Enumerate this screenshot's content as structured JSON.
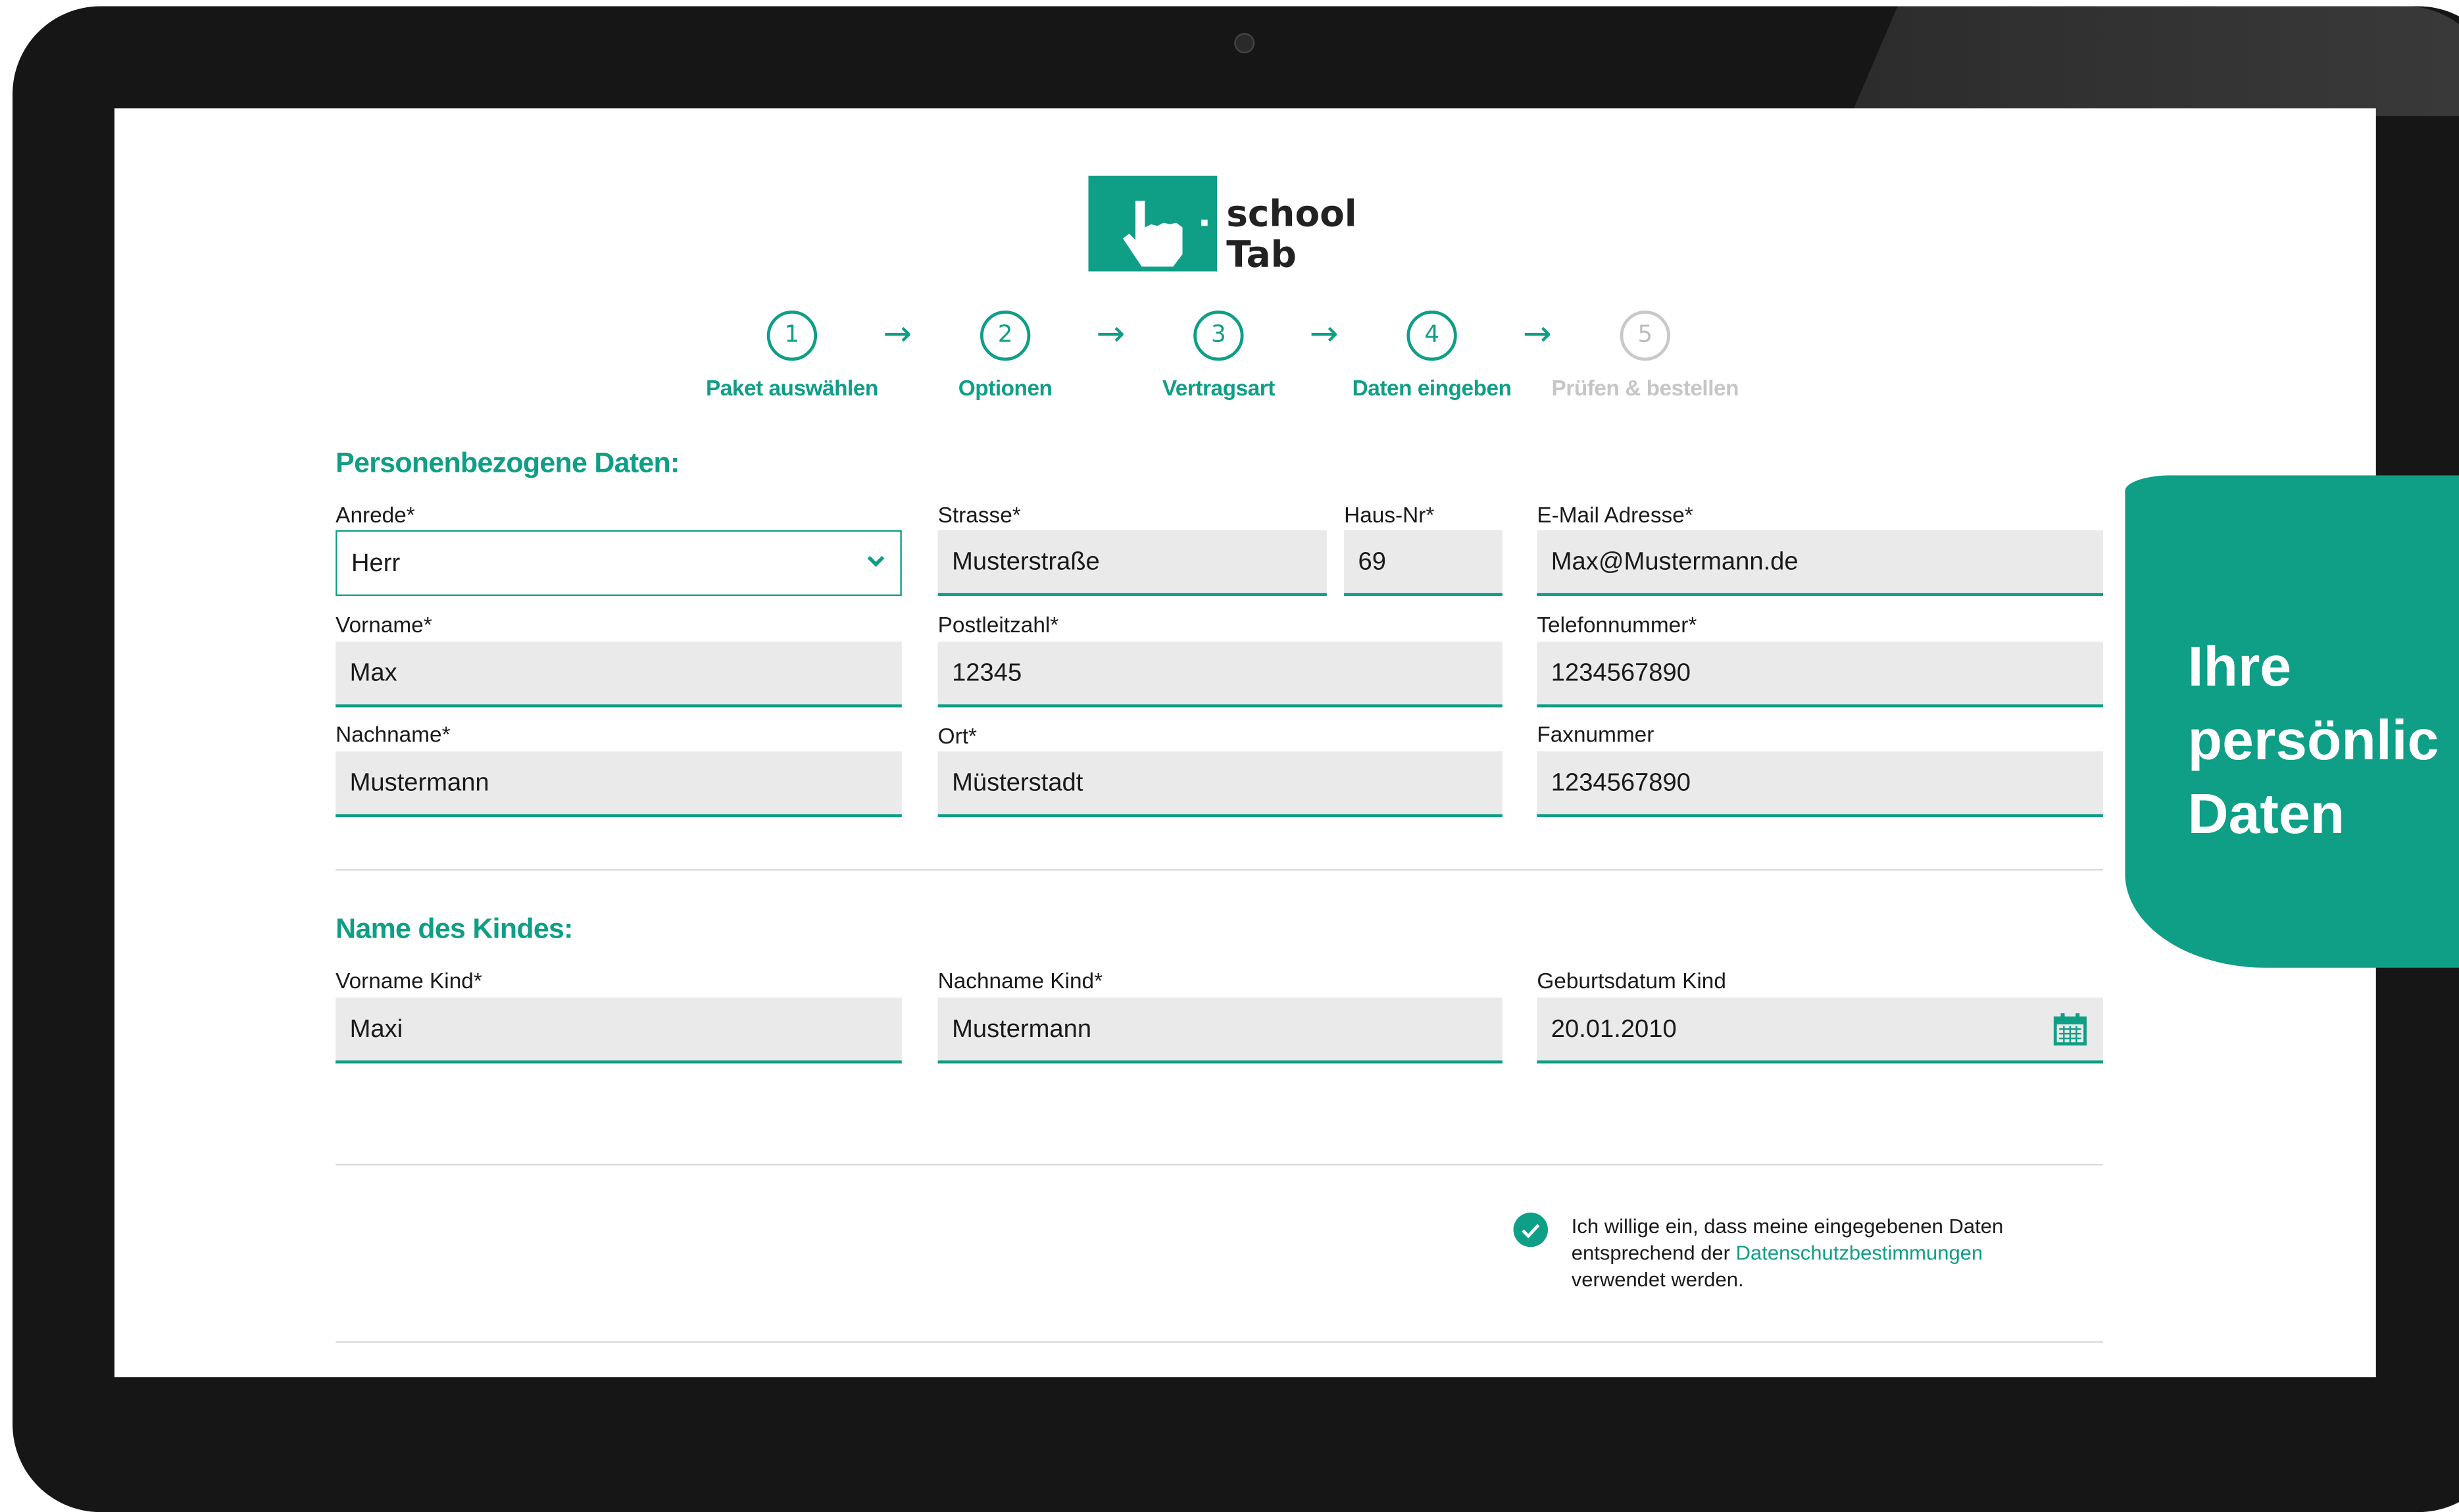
{
  "brand": {
    "line1": "school",
    "line2": "Tab",
    "color": "#0f9e86"
  },
  "steps": [
    {
      "num": "1",
      "label": "Paket auswählen",
      "state": "done"
    },
    {
      "num": "2",
      "label": "Optionen",
      "state": "done"
    },
    {
      "num": "3",
      "label": "Vertragsart",
      "state": "done"
    },
    {
      "num": "4",
      "label": "Daten eingeben",
      "state": "current"
    },
    {
      "num": "5",
      "label": "Prüfen & bestellen",
      "state": "inactive"
    }
  ],
  "arrow": "→",
  "personal": {
    "heading": "Personenbezogene Daten:",
    "anrede": {
      "label": "Anrede*",
      "value": "Herr"
    },
    "strasse": {
      "label": "Strasse*",
      "value": "Musterstraße"
    },
    "hausnr": {
      "label": "Haus-Nr*",
      "value": "69"
    },
    "email": {
      "label": "E-Mail Adresse*",
      "value": "Max@Mustermann.de"
    },
    "vorname": {
      "label": "Vorname*",
      "value": "Max"
    },
    "plz": {
      "label": "Postleitzahl*",
      "value": "12345"
    },
    "telefon": {
      "label": "Telefonnummer*",
      "value": "1234567890"
    },
    "nachname": {
      "label": "Nachname*",
      "value": "Mustermann"
    },
    "ort": {
      "label": "Ort*",
      "value": "Müsterstadt"
    },
    "fax": {
      "label": "Faxnummer",
      "value": "1234567890"
    }
  },
  "child": {
    "heading": "Name des Kindes:",
    "vorname": {
      "label": "Vorname Kind*",
      "value": "Maxi"
    },
    "nachname": {
      "label": "Nachname Kind*",
      "value": "Mustermann"
    },
    "geburtsdatum": {
      "label": "Geburtsdatum Kind",
      "value": "20.01.2010"
    }
  },
  "consent": {
    "checked": true,
    "text_before": "Ich willige ein, dass meine eingegebenen Daten entsprechend der ",
    "link": "Datenschutzbestimmungen",
    "text_after": " verwendet werden."
  },
  "badge": {
    "line1": "Ihre",
    "line2": "persönlic",
    "line3": "Daten"
  }
}
